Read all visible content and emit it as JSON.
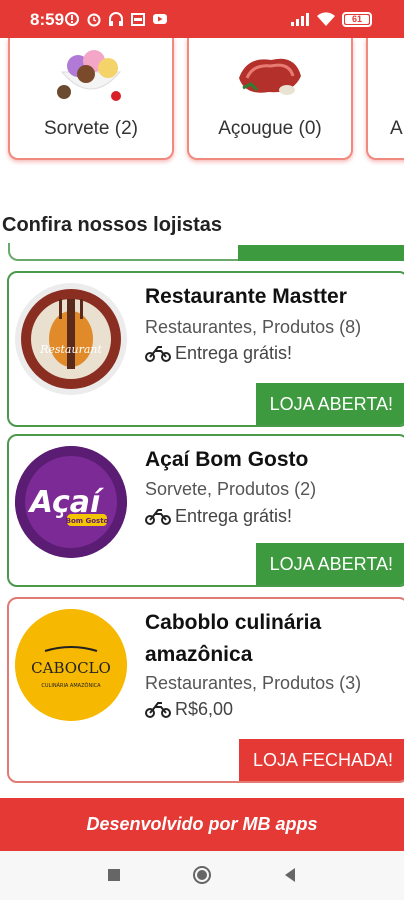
{
  "status_bar": {
    "time": "8:59",
    "battery": "61",
    "left_icons": [
      "alert-badge-icon",
      "alarm-icon",
      "headphones-icon",
      "calendar-icon",
      "youtube-icon"
    ],
    "right_icons": [
      "signal-icon",
      "wifi-icon",
      "battery-icon"
    ]
  },
  "categories": [
    {
      "label": "Sorvete (2)",
      "icon": "ice-cream-icon"
    },
    {
      "label": "Açougue (0)",
      "icon": "meat-icon"
    },
    {
      "label": "A",
      "icon": "category-icon"
    }
  ],
  "section_title": "Confira nossos lojistas",
  "stores": [
    {
      "name": "Restaurante Mastter",
      "categories": "Restaurantes, Produtos (8)",
      "delivery": "Entrega grátis!",
      "status": "LOJA ABERTA!",
      "status_color": "#3e9a3e",
      "logo_text": "Restaurant"
    },
    {
      "name": "Açaí Bom Gosto",
      "categories": "Sorvete, Produtos (2)",
      "delivery": "Entrega grátis!",
      "status": "LOJA ABERTA!",
      "status_color": "#3e9a3e",
      "logo_text": "Açaí",
      "logo_subtext": "Bom Gosto"
    },
    {
      "name": "Caboblo culinária amazônica",
      "categories": "Restaurantes, Produtos (3)",
      "delivery": "R$6,00",
      "status": "LOJA FECHADA!",
      "status_color": "#e53935",
      "logo_text": "CABOCLO",
      "logo_subtext": "CULINÁRIA AMAZÔNICA"
    }
  ],
  "footer": "Desenvolvido por MB apps",
  "colors": {
    "brand": "#e53935",
    "open": "#3e9a3e",
    "closed": "#e53935"
  },
  "nav": [
    "recents-button",
    "home-button",
    "back-button"
  ]
}
